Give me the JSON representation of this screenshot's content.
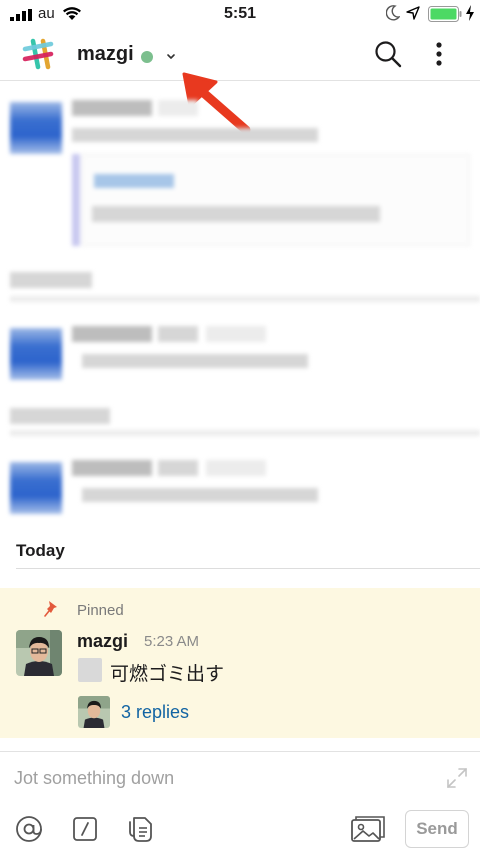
{
  "status_bar": {
    "carrier": "au",
    "time": "5:51"
  },
  "header": {
    "channel_name": "mazgi",
    "presence_color": "#7cbf8e"
  },
  "icons": {
    "logo": "slack-logo-icon",
    "presence": "presence-dot-icon",
    "chevron": "chevron-down-icon",
    "search": "search-icon",
    "more": "more-vertical-icon",
    "pin": "pin-icon",
    "at": "at-sign-icon",
    "slash": "slash-command-icon",
    "file": "file-icon",
    "photo": "photo-icon",
    "expand": "expand-icon"
  },
  "timeline": {
    "divider_label": "Today",
    "pinned_message": {
      "pinned_label": "Pinned",
      "author": "mazgi",
      "time": "5:23 AM",
      "text": "可燃ゴミ出す",
      "replies_label": "3 replies"
    }
  },
  "composer": {
    "placeholder": "Jot something down",
    "value": "",
    "send_label": "Send"
  },
  "colors": {
    "link": "#1264a3",
    "pinned_background": "#fdf8e1",
    "annotation_arrow": "#e8391f"
  }
}
